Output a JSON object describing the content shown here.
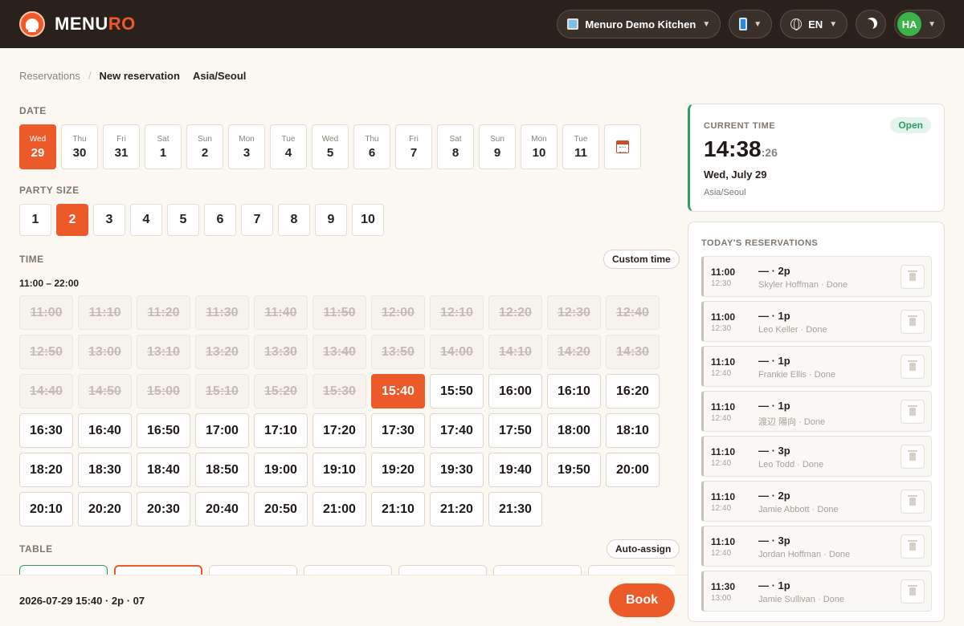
{
  "header": {
    "brand_main": "MENU",
    "brand_accent": "RO",
    "kitchen": "Menuro Demo Kitchen",
    "language": "EN",
    "avatar": "HA"
  },
  "breadcrumb": {
    "root": "Reservations",
    "current": "New reservation",
    "timezone": "Asia/Seoul"
  },
  "date_section": {
    "label": "DATE",
    "dates": [
      {
        "day": "Wed",
        "num": "29",
        "selected": true
      },
      {
        "day": "Thu",
        "num": "30"
      },
      {
        "day": "Fri",
        "num": "31"
      },
      {
        "day": "Sat",
        "num": "1"
      },
      {
        "day": "Sun",
        "num": "2"
      },
      {
        "day": "Mon",
        "num": "3"
      },
      {
        "day": "Tue",
        "num": "4"
      },
      {
        "day": "Wed",
        "num": "5"
      },
      {
        "day": "Thu",
        "num": "6"
      },
      {
        "day": "Fri",
        "num": "7"
      },
      {
        "day": "Sat",
        "num": "8"
      },
      {
        "day": "Sun",
        "num": "9"
      },
      {
        "day": "Mon",
        "num": "10"
      },
      {
        "day": "Tue",
        "num": "11"
      }
    ]
  },
  "party_section": {
    "label": "PARTY SIZE",
    "sizes": [
      "1",
      "2",
      "3",
      "4",
      "5",
      "6",
      "7",
      "8",
      "9",
      "10"
    ],
    "selected": "2"
  },
  "time_section": {
    "label": "TIME",
    "custom_label": "Custom time",
    "range": "11:00 – 22:00",
    "past": [
      "11:00",
      "11:10",
      "11:20",
      "11:30",
      "11:40",
      "11:50",
      "12:00",
      "12:10",
      "12:20",
      "12:30",
      "12:40",
      "12:50",
      "13:00",
      "13:10",
      "13:20",
      "13:30",
      "13:40",
      "13:50",
      "14:00",
      "14:10",
      "14:20",
      "14:30",
      "14:40",
      "14:50",
      "15:00",
      "15:10",
      "15:20",
      "15:30"
    ],
    "available": [
      "15:40",
      "15:50",
      "16:00",
      "16:10",
      "16:20",
      "16:30",
      "16:40",
      "16:50",
      "17:00",
      "17:10",
      "17:20",
      "17:30",
      "17:40",
      "17:50",
      "18:00",
      "18:10",
      "18:20",
      "18:30",
      "18:40",
      "18:50",
      "19:00",
      "19:10",
      "19:20",
      "19:30",
      "19:40",
      "19:50",
      "20:00",
      "20:10",
      "20:20",
      "20:30",
      "20:40",
      "20:50",
      "21:00",
      "21:10",
      "21:20",
      "21:30"
    ],
    "selected": "15:40"
  },
  "table_section": {
    "label": "TABLE",
    "auto_label": "Auto-assign"
  },
  "bottom": {
    "summary": "2026-07-29 15:40 · 2p · 07",
    "book_label": "Book"
  },
  "current_time": {
    "label": "CURRENT TIME",
    "status": "Open",
    "hm": "14:38",
    "sec": ":26",
    "date": "Wed, July 29",
    "timezone": "Asia/Seoul"
  },
  "todays": {
    "label": "TODAY'S RESERVATIONS",
    "items": [
      {
        "start": "11:00",
        "end": "12:30",
        "party": "— · 2p",
        "who": "Skyler Hoffman · Done"
      },
      {
        "start": "11:00",
        "end": "12:30",
        "party": "— · 1p",
        "who": "Leo Keller · Done"
      },
      {
        "start": "11:10",
        "end": "12:40",
        "party": "— · 1p",
        "who": "Frankie Ellis · Done"
      },
      {
        "start": "11:10",
        "end": "12:40",
        "party": "— · 1p",
        "who": "渡辺 陽向 · Done"
      },
      {
        "start": "11:10",
        "end": "12:40",
        "party": "— · 3p",
        "who": "Leo Todd · Done"
      },
      {
        "start": "11:10",
        "end": "12:40",
        "party": "— · 2p",
        "who": "Jamie Abbott · Done"
      },
      {
        "start": "11:10",
        "end": "12:40",
        "party": "— · 3p",
        "who": "Jordan Hoffman · Done"
      },
      {
        "start": "11:30",
        "end": "13:00",
        "party": "— · 1p",
        "who": "Jamie Sullivan · Done"
      }
    ]
  }
}
